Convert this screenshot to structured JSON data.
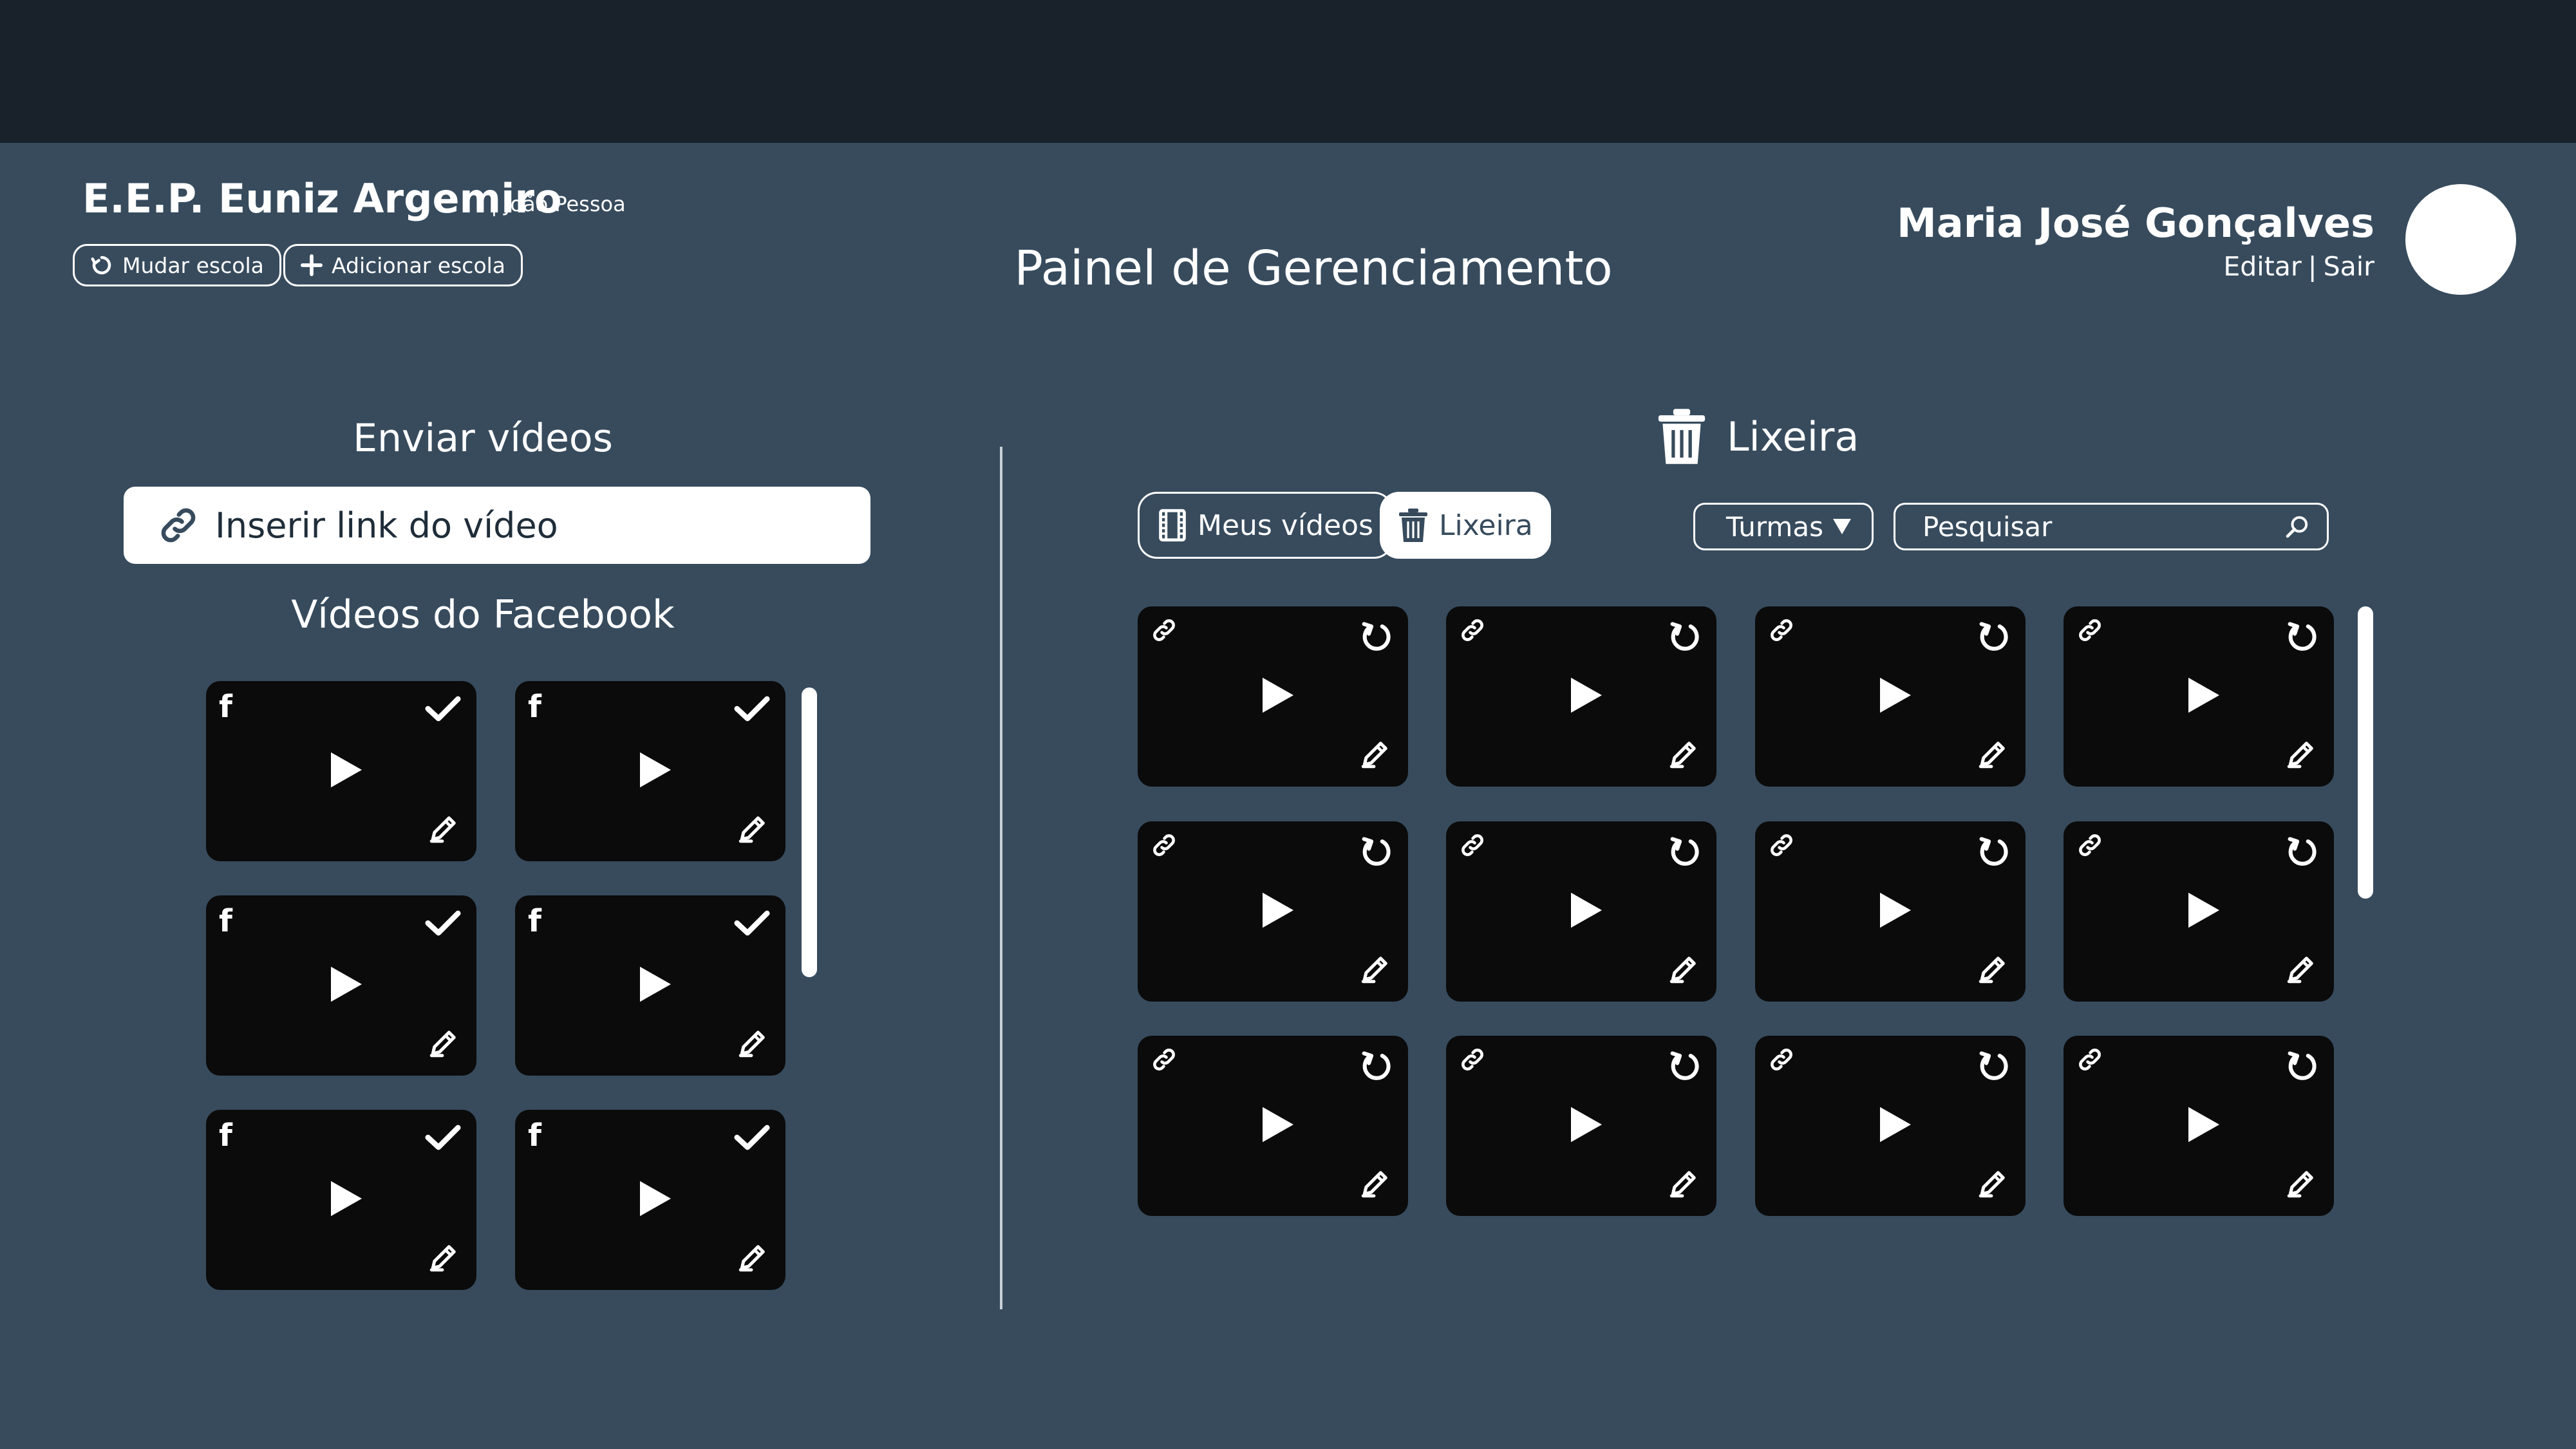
{
  "header": {
    "school_name": "E.E.P. Euniz Argemiro",
    "school_city": "| João Pessoa",
    "change_school": "Mudar escola",
    "add_school": "Adicionar escola",
    "page_title": "Painel de Gerenciamento",
    "user_name": "Maria José Gonçalves",
    "edit_link": "Editar",
    "separator": "|",
    "logout_link": "Sair"
  },
  "upload": {
    "title": "Enviar vídeos",
    "link_placeholder": "Inserir link do vídeo",
    "facebook_title": "Vídeos do Facebook",
    "facebook_videos": [
      {
        "source_icon": "facebook-icon",
        "status_icon": "check-icon",
        "action_icon": "pencil-icon"
      },
      {
        "source_icon": "facebook-icon",
        "status_icon": "check-icon",
        "action_icon": "pencil-icon"
      },
      {
        "source_icon": "facebook-icon",
        "status_icon": "check-icon",
        "action_icon": "pencil-icon"
      },
      {
        "source_icon": "facebook-icon",
        "status_icon": "check-icon",
        "action_icon": "pencil-icon"
      },
      {
        "source_icon": "facebook-icon",
        "status_icon": "check-icon",
        "action_icon": "pencil-icon"
      },
      {
        "source_icon": "facebook-icon",
        "status_icon": "check-icon",
        "action_icon": "pencil-icon"
      }
    ]
  },
  "trash": {
    "title": "Lixeira",
    "tab_my_videos": "Meus vídeos",
    "tab_trash": "Lixeira",
    "active_tab": "Lixeira",
    "class_filter": "Turmas",
    "search_placeholder": "Pesquisar",
    "videos_count": 12,
    "video_icons": {
      "top_left": "link-icon",
      "top_right": "restore-icon",
      "bottom_right": "pencil-icon"
    }
  },
  "colors": {
    "background": "#374b5d",
    "topbar": "#19212a",
    "tile": "#0b0b0b",
    "text": "#ffffff"
  }
}
